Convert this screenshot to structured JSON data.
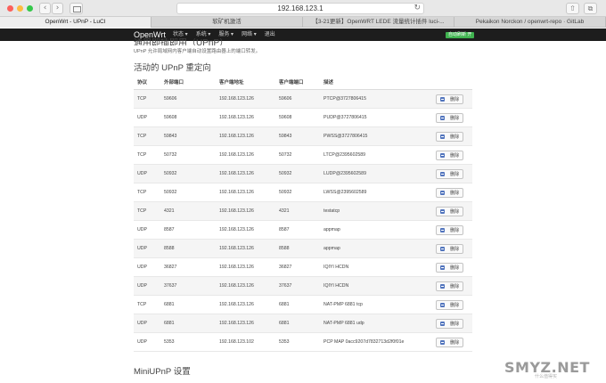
{
  "browser": {
    "address": "192.168.123.1",
    "back_icon": "‹",
    "forward_icon": "›",
    "reload_icon": "↻",
    "share_icon": "⇧",
    "tabs_icon": "⧉",
    "tabs": [
      {
        "label": "OpenWrt - UPnP - LuCI"
      },
      {
        "label": "软矿机激活"
      },
      {
        "label": "【3-21更新】OpenWRT LEDE 流量统计插件 luci-..."
      },
      {
        "label": "Pekaikon Norckon / openwrt-repo · GitLab"
      }
    ]
  },
  "header": {
    "brand": "OpenWrt",
    "menu": [
      "状态 ▾",
      "系统 ▾",
      "服务 ▾",
      "网络 ▾",
      "退出"
    ],
    "refresh_badge": "自动刷新 开"
  },
  "page": {
    "partial_title": "通用即插即用（UPnP）",
    "description": "UPnP 允许局域网内客户端自动设置路由器上的端口转发。",
    "section_title": "活动的 UPnP 重定向",
    "settings_title": "MiniUPnP 设置"
  },
  "table": {
    "headers": {
      "protocol": "协议",
      "external_port": "外部端口",
      "client_address": "客户端地址",
      "client_port": "客户端端口",
      "description": "描述"
    },
    "delete_label": "删除",
    "rows": [
      {
        "protocol": "TCP",
        "external_port": "59606",
        "client_address": "192.168.123.126",
        "client_port": "59606",
        "description": "PTCP@3727806415"
      },
      {
        "protocol": "UDP",
        "external_port": "59608",
        "client_address": "192.168.123.126",
        "client_port": "59608",
        "description": "PUDP@3727806415"
      },
      {
        "protocol": "TCP",
        "external_port": "59843",
        "client_address": "192.168.123.126",
        "client_port": "59843",
        "description": "PWSS@3727806415"
      },
      {
        "protocol": "TCP",
        "external_port": "50732",
        "client_address": "192.168.123.126",
        "client_port": "50732",
        "description": "LTCP@2395602589"
      },
      {
        "protocol": "UDP",
        "external_port": "50932",
        "client_address": "192.168.123.126",
        "client_port": "50932",
        "description": "LUDP@2395602589"
      },
      {
        "protocol": "TCP",
        "external_port": "50932",
        "client_address": "192.168.123.126",
        "client_port": "50932",
        "description": "LWSS@2395602589"
      },
      {
        "protocol": "TCP",
        "external_port": "4321",
        "client_address": "192.168.123.126",
        "client_port": "4321",
        "description": "testatcp"
      },
      {
        "protocol": "UDP",
        "external_port": "8587",
        "client_address": "192.168.123.126",
        "client_port": "8587",
        "description": "appmap"
      },
      {
        "protocol": "UDP",
        "external_port": "8588",
        "client_address": "192.168.123.126",
        "client_port": "8588",
        "description": "appmap"
      },
      {
        "protocol": "UDP",
        "external_port": "36827",
        "client_address": "192.168.123.126",
        "client_port": "36827",
        "description": "IQIYI HCDN"
      },
      {
        "protocol": "UDP",
        "external_port": "37637",
        "client_address": "192.168.123.126",
        "client_port": "37637",
        "description": "IQIYI HCDN"
      },
      {
        "protocol": "TCP",
        "external_port": "6881",
        "client_address": "192.168.123.126",
        "client_port": "6881",
        "description": "NAT-PMP 6881 tcp"
      },
      {
        "protocol": "UDP",
        "external_port": "6881",
        "client_address": "192.168.123.126",
        "client_port": "6881",
        "description": "NAT-PMP 6881 udp"
      },
      {
        "protocol": "UDP",
        "external_port": "5353",
        "client_address": "192.168.123.102",
        "client_port": "5353",
        "description": "PCP MAP 0acc9207d7832713d2f0f01e"
      }
    ]
  },
  "watermark": {
    "text": "SMYZ.NET",
    "sub": "什么值得买"
  },
  "colors": {
    "header_bg": "#1d1d1d",
    "badge_green": "#3fb34f",
    "delete_icon": "#5174bd"
  }
}
